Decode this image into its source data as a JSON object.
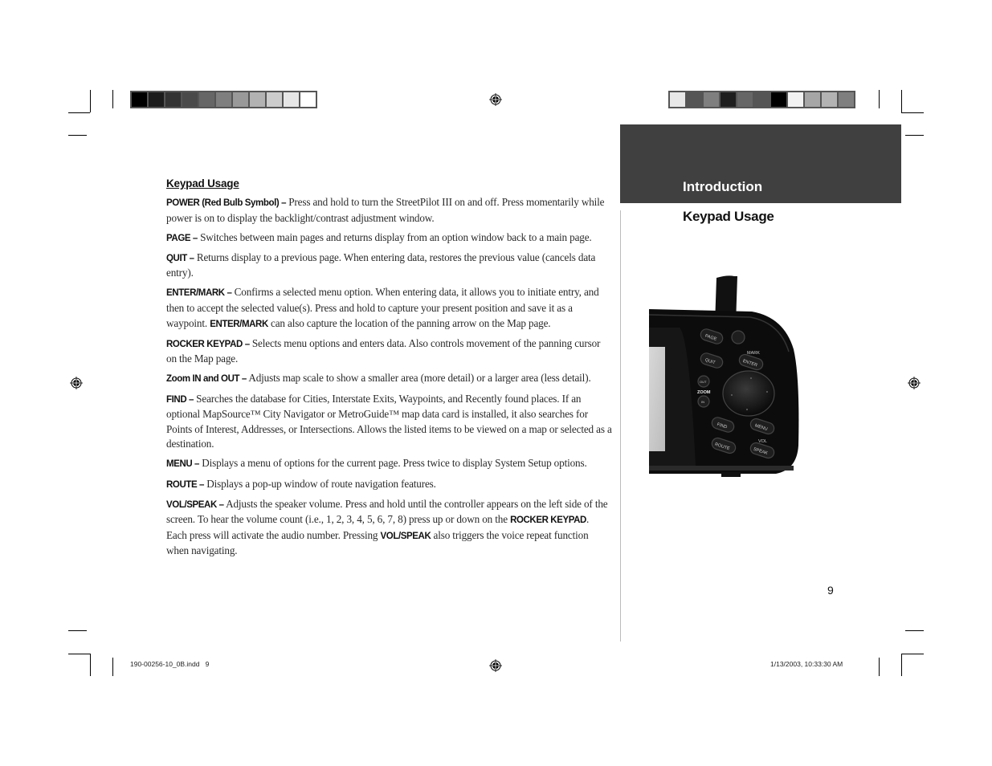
{
  "document": {
    "section_band_title": "Introduction",
    "section_title": "Keypad Usage",
    "heading": "Keypad Usage",
    "page_number": "9",
    "slug_left": "190-00256-10_0B.indd   9",
    "slug_right": "1/13/2003, 10:33:30 AM",
    "entries": [
      {
        "term": "POWER (Red Bulb Symbol) –",
        "text": " Press and hold to turn the StreetPilot III on and off. Press momentarily while power is on to display the backlight/contrast adjustment window."
      },
      {
        "term": "PAGE –",
        "text": " Switches between main pages and returns display from an option window back to a main page."
      },
      {
        "term": "QUIT –",
        "text": " Returns display to a previous page. When entering data, restores the previous value (cancels data entry)."
      },
      {
        "term": "ENTER/MARK –",
        "text": " Confirms a selected menu option. When entering data, it allows you to initiate entry, and then to accept the selected value(s). Press and hold to capture your present position and save it as a waypoint. ",
        "bold2": "ENTER/MARK",
        "text2": " can also capture the location of the panning arrow on the Map page."
      },
      {
        "term": "ROCKER KEYPAD –",
        "text": " Selects menu options and enters data. Also controls movement of the panning cursor on the Map page."
      },
      {
        "term": "Zoom IN and OUT –",
        "text": " Adjusts map scale to show a smaller area (more detail) or a larger area (less detail)."
      },
      {
        "term": "FIND –",
        "text": " Searches the database for Cities, Interstate Exits, Waypoints, and Recently found places. If an optional MapSource™ City Navigator or MetroGuide™ map data card is installed, it also searches for Points of Interest, Addresses, or Intersections. Allows the listed items to be viewed on a map or selected as a destination."
      },
      {
        "term": "MENU –",
        "text": " Displays a menu of options for the current page. Press twice to display System Setup options."
      },
      {
        "term": "ROUTE –",
        "text": " Displays a pop-up window of route navigation features."
      },
      {
        "term": "VOL/SPEAK –",
        "text": " Adjusts the speaker volume. Press and hold until the controller appears on the left side of the screen. To hear the volume count (i.e., 1, 2, 3, 4, 5, 6, 7, 8) press up or down on the ",
        "bold2": "ROCKER KEYPAD",
        "text2": ". Each press will activate the audio number. Pressing ",
        "bold3": "VOL/SPEAK",
        "text3": " also triggers the voice repeat function when navigating."
      }
    ]
  },
  "device_image": {
    "labels": {
      "page": "PAGE",
      "quit": "QUIT",
      "mark": "MARK",
      "enter": "ENTER",
      "out": "OUT",
      "zoom": "ZOOM",
      "in": "IN",
      "find": "FIND",
      "menu": "MENU",
      "vol": "VOL",
      "speak": "SPEAK",
      "route": "ROUTE"
    }
  },
  "colorbars": {
    "left": [
      "#000000",
      "#1c1c1c",
      "#333333",
      "#4a4a4a",
      "#666666",
      "#7f7f7f",
      "#999999",
      "#b2b2b2",
      "#cccccc",
      "#e6e6e6",
      "#ffffff"
    ],
    "right": [
      "#e8e8e8",
      "#555555",
      "#7f7f7f",
      "#1e1e1e",
      "#666666",
      "#555555",
      "#000000",
      "#f2f2f2",
      "#a6a6a6",
      "#b3b3b3",
      "#7f7f7f"
    ]
  }
}
